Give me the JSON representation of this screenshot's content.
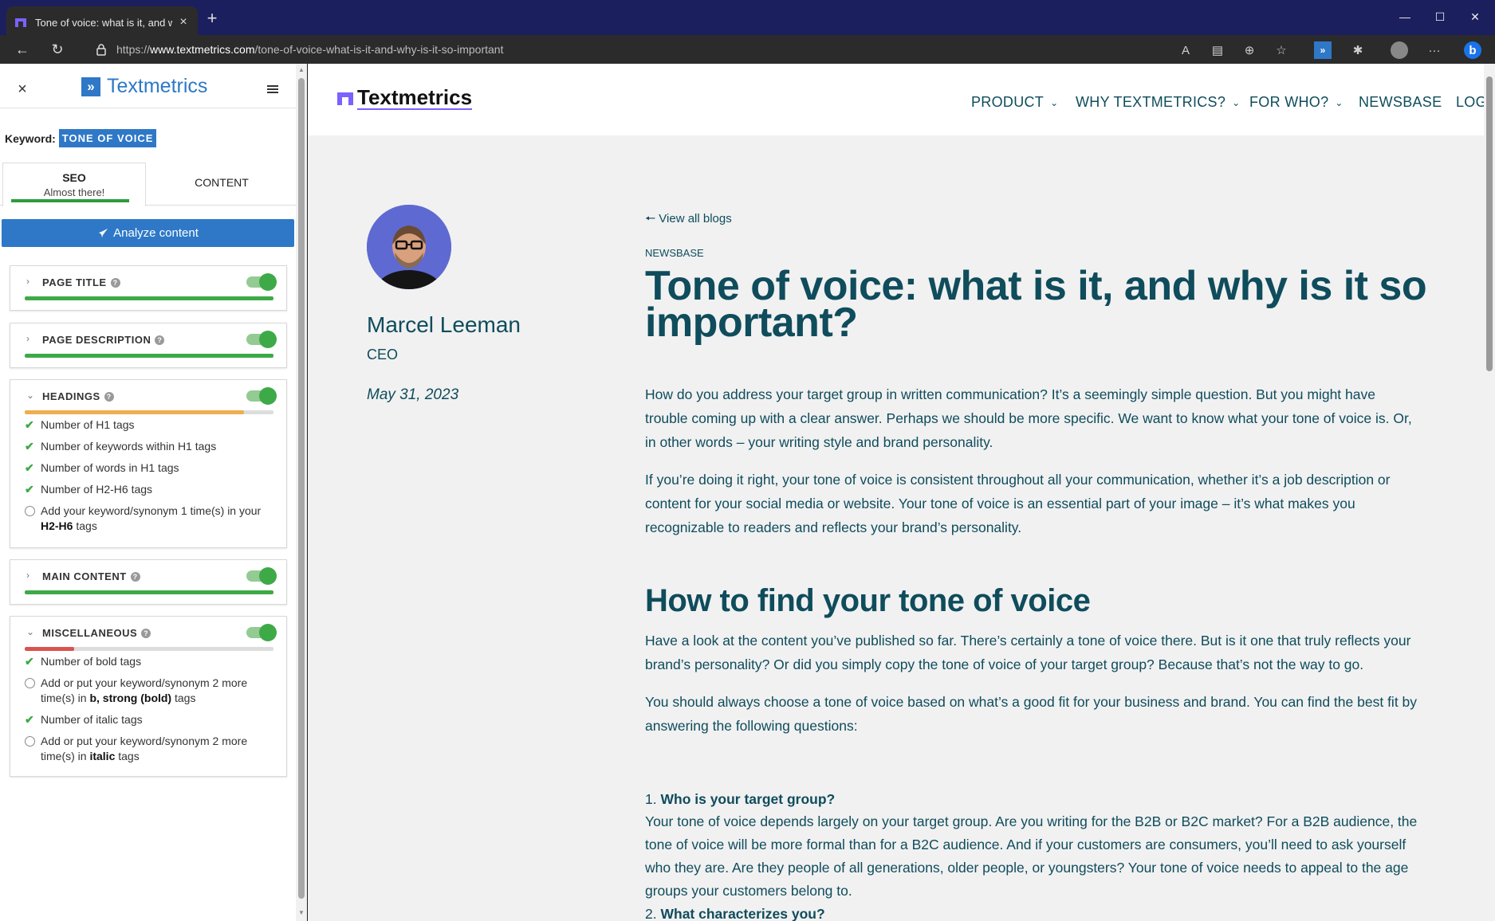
{
  "browser": {
    "tab_title": "Tone of voice: what is it, and why",
    "url_prefix": "https://",
    "url_host": "www.textmetrics.com",
    "url_path": "/tone-of-voice-what-is-it-and-why-is-it-so-important"
  },
  "sidebar": {
    "brand": "Textmetrics",
    "keyword_label": "Keyword:",
    "keyword": "TONE OF VOICE",
    "tabs": {
      "seo": "SEO",
      "seo_status": "Almost there!",
      "content": "CONTENT"
    },
    "analyze_label": "Analyze content",
    "panels": {
      "page_title": {
        "title": "PAGE TITLE",
        "progress": 1.0
      },
      "page_description": {
        "title": "PAGE DESCRIPTION",
        "progress": 1.0
      },
      "headings": {
        "title": "HEADINGS",
        "progress": 0.88,
        "items": [
          "Number of H1 tags",
          "Number of keywords within H1 tags",
          "Number of words in H1 tags",
          "Number of H2-H6 tags",
          "Add your keyword/synonym 1 time(s) in your",
          "H2-H6",
          "tags"
        ]
      },
      "main_content": {
        "title": "MAIN CONTENT",
        "progress": 1.0
      },
      "miscellaneous": {
        "title": "MISCELLANEOUS",
        "progress": 0.2,
        "items": [
          "Number of bold tags",
          "Add or put your keyword/synonym 2 more time(s) in",
          "b, strong (bold)",
          "tags",
          "Number of italic tags",
          "Add or put your keyword/synonym 2 more time(s) in",
          "italic",
          "tags"
        ]
      }
    }
  },
  "site": {
    "brand": "Textmetrics",
    "nav": [
      "PRODUCT",
      "WHY TEXTMETRICS?",
      "FOR WHO?",
      "NEWSBASE",
      "LOG"
    ],
    "author": "Marcel Leeman",
    "role": "CEO",
    "date": "May 31, 2023",
    "back_link": "View all blogs",
    "category": "NEWSBASE",
    "title": "Tone of voice: what is it, and why is it so important?",
    "p1": "How do you address your target group in written communication? It’s a seemingly simple question. But you might have trouble coming up with a clear answer. Perhaps we should be more specific. We want to know what your tone of voice is. Or, in other words – your writing style and brand personality.",
    "p2": "If you’re doing it right, your tone of voice is consistent throughout all your communication, whether it’s a job description or content for your social media or website. Your tone of voice is an essential part of your image – it’s what makes you recognizable to readers and reflects your brand’s personality.",
    "h2": "How to find your tone of voice",
    "p3": "Have a look at the content you’ve published so far. There’s certainly a tone of voice there. But is it one that truly reflects your brand’s personality? Or did you simply copy the tone of voice of your target group? Because that’s not the way to go.",
    "p4": "You should always choose a tone of voice based on what’s a good fit for your business and brand. You can find the best fit by answering the following questions:",
    "q1_num": "1.",
    "q1": "Who is your target group?",
    "p5": "Your tone of voice depends largely on your target group. Are you writing for the B2B or B2C market? For a B2B audience, the tone of voice will be more formal than for a B2C audience. And if your customers are consumers, you’ll need to ask yourself who they are. Are they people of all generations, older people, or youngsters? Your tone of voice needs to appeal to the age groups your customers belong to.",
    "q2_num": "2.",
    "q2": "What characterizes you?"
  },
  "colors": {
    "brand_blue": "#2e78c7",
    "site_teal": "#0f4c5c",
    "ok_green": "#3daa47",
    "warn_orange": "#f0ad4e",
    "bad_red": "#d9534f"
  }
}
